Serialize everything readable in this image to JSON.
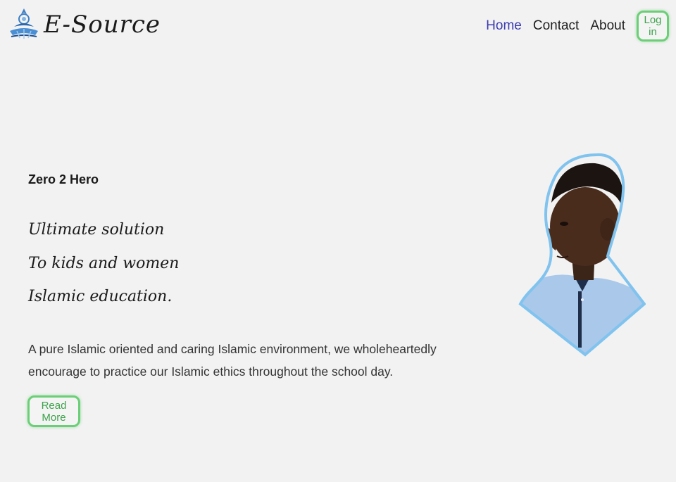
{
  "header": {
    "brand": "E-Source",
    "nav": {
      "home": "Home",
      "contact": "Contact",
      "about": "About",
      "login": "Log in"
    }
  },
  "hero": {
    "eyebrow": "Zero 2 Hero",
    "taglines": [
      "Ultimate solution",
      "To kids and women",
      "Islamic education."
    ],
    "description": "A pure Islamic oriented and caring Islamic environment, we wholeheartedly encourage to practice our Islamic ethics throughout the school day.",
    "read_more": "Read More"
  },
  "colors": {
    "background": "#f2f2f2",
    "active_nav": "#3b3bb0",
    "button_border": "#6ccf78",
    "button_text": "#3ea34c",
    "image_border": "#7fc3ee"
  },
  "icons": {
    "logo": "e-source-logo-icon",
    "hero_image": "boy-portrait-image"
  }
}
